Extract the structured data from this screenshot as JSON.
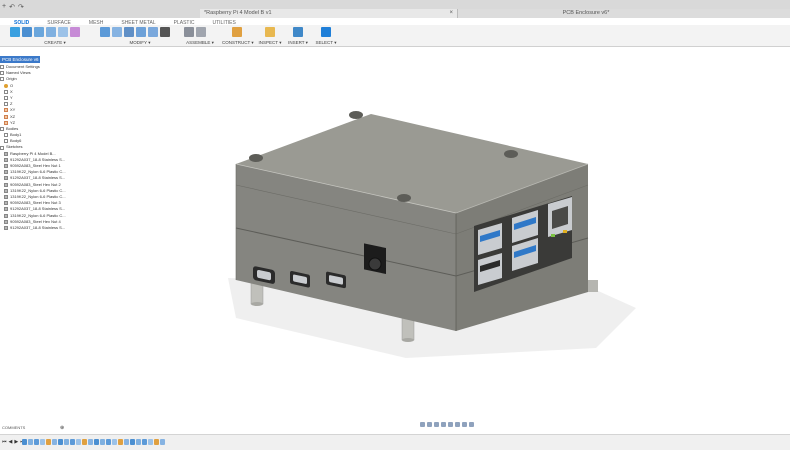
{
  "titlebar": {
    "quick_access": [
      "+",
      "↶",
      "↷"
    ],
    "document_tab": "*Raspberry Pi 4 Model B v1",
    "document_tab_2": "PCB Enclosure v6*",
    "close_glyph": "×"
  },
  "workspace_tabs": [
    "SOLID",
    "SURFACE",
    "MESH",
    "SHEET METAL",
    "PLASTIC",
    "UTILITIES"
  ],
  "toolbar": {
    "groups": [
      "CREATE ▾",
      "MODIFY ▾",
      "ASSEMBLE ▾",
      "CONSTRUCT ▾",
      "INSPECT ▾",
      "INSERT ▾",
      "SELECT ▾"
    ]
  },
  "browser": {
    "header": "BROWSER",
    "root": "PCB Enclosure v6",
    "items": [
      {
        "kind": "folder",
        "label": "Document Settings"
      },
      {
        "kind": "folder",
        "label": "Named Views"
      },
      {
        "kind": "folder",
        "label": "Origin"
      },
      {
        "kind": "origin",
        "label": "O"
      },
      {
        "kind": "axis",
        "label": "X"
      },
      {
        "kind": "axis",
        "label": "Y"
      },
      {
        "kind": "axis",
        "label": "Z"
      },
      {
        "kind": "plane",
        "label": "XY"
      },
      {
        "kind": "plane",
        "label": "XZ"
      },
      {
        "kind": "plane",
        "label": "YZ"
      },
      {
        "kind": "folder",
        "label": "Bodies"
      },
      {
        "kind": "body",
        "label": "Body1"
      },
      {
        "kind": "body",
        "label": "Body6"
      },
      {
        "kind": "folder",
        "label": "Sketches"
      },
      {
        "kind": "comp",
        "label": "Raspberry Pi 4 Model B..."
      },
      {
        "kind": "comp",
        "label": "91292A037_18-8 Stainless S..."
      },
      {
        "kind": "comp",
        "label": "90592A083_Steel Hex Nut 1"
      },
      {
        "kind": "comp",
        "label": "1319K22_Nylon 6-6 Plastic C..."
      },
      {
        "kind": "comp",
        "label": "91292A037_18-8 Stainless S..."
      },
      {
        "kind": "comp",
        "label": "90592A083_Steel Hex Nut 2"
      },
      {
        "kind": "comp",
        "label": "1319K22_Nylon 6-6 Plastic C..."
      },
      {
        "kind": "comp",
        "label": "1319K22_Nylon 6-6 Plastic C..."
      },
      {
        "kind": "comp",
        "label": "90592A083_Steel Hex Nut 3"
      },
      {
        "kind": "comp",
        "label": "91292A037_18-8 Stainless S..."
      },
      {
        "kind": "comp",
        "label": "1319K22_Nylon 6-6 Plastic C..."
      },
      {
        "kind": "comp",
        "label": "90592A083_Steel Hex Nut 4"
      },
      {
        "kind": "comp",
        "label": "91292A037_18-8 Stainless S..."
      }
    ]
  },
  "comments": {
    "label": "COMMENTS",
    "add": "⊕"
  },
  "timeline": {
    "controls": [
      "⏮",
      "◀",
      "▶",
      "⏭"
    ]
  },
  "colors": {
    "accent": "#0b6fd6",
    "enclosure_top": "#9a9a93",
    "enclosure_side": "#7d7d77",
    "enclosure_front": "#858580",
    "usb_blue": "#2f78c8",
    "port_metal": "#c9ccd0"
  }
}
